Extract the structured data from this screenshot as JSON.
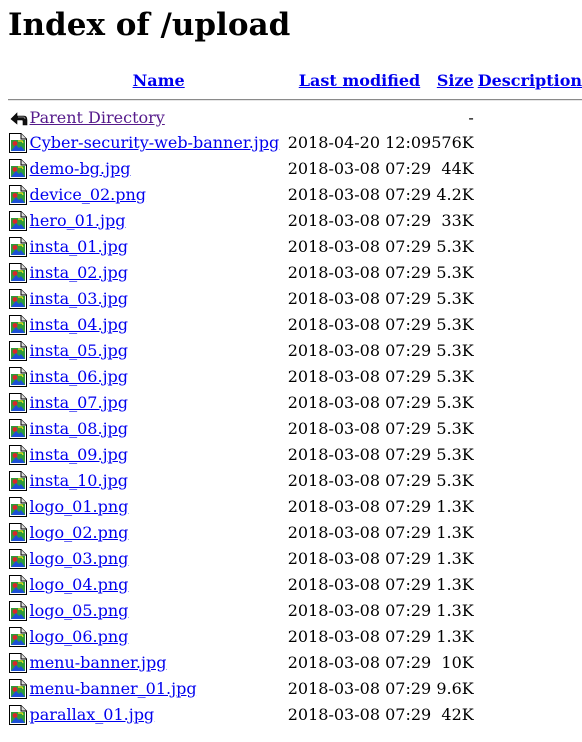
{
  "page": {
    "title": "Index of /upload"
  },
  "headers": {
    "name": "Name",
    "last_modified": "Last modified",
    "size": "Size",
    "description": "Description"
  },
  "parent": {
    "label": "Parent Directory",
    "size": "-",
    "icon": "back-icon"
  },
  "files": [
    {
      "name": "Cyber-security-web-banner.jpg",
      "modified": "2018-04-20 12:09",
      "size": "576K",
      "icon": "image-file-icon"
    },
    {
      "name": "demo-bg.jpg",
      "modified": "2018-03-08 07:29",
      "size": "44K",
      "icon": "image-file-icon"
    },
    {
      "name": "device_02.png",
      "modified": "2018-03-08 07:29",
      "size": "4.2K",
      "icon": "image-file-icon"
    },
    {
      "name": "hero_01.jpg",
      "modified": "2018-03-08 07:29",
      "size": "33K",
      "icon": "image-file-icon"
    },
    {
      "name": "insta_01.jpg",
      "modified": "2018-03-08 07:29",
      "size": "5.3K",
      "icon": "image-file-icon"
    },
    {
      "name": "insta_02.jpg",
      "modified": "2018-03-08 07:29",
      "size": "5.3K",
      "icon": "image-file-icon"
    },
    {
      "name": "insta_03.jpg",
      "modified": "2018-03-08 07:29",
      "size": "5.3K",
      "icon": "image-file-icon"
    },
    {
      "name": "insta_04.jpg",
      "modified": "2018-03-08 07:29",
      "size": "5.3K",
      "icon": "image-file-icon"
    },
    {
      "name": "insta_05.jpg",
      "modified": "2018-03-08 07:29",
      "size": "5.3K",
      "icon": "image-file-icon"
    },
    {
      "name": "insta_06.jpg",
      "modified": "2018-03-08 07:29",
      "size": "5.3K",
      "icon": "image-file-icon"
    },
    {
      "name": "insta_07.jpg",
      "modified": "2018-03-08 07:29",
      "size": "5.3K",
      "icon": "image-file-icon"
    },
    {
      "name": "insta_08.jpg",
      "modified": "2018-03-08 07:29",
      "size": "5.3K",
      "icon": "image-file-icon"
    },
    {
      "name": "insta_09.jpg",
      "modified": "2018-03-08 07:29",
      "size": "5.3K",
      "icon": "image-file-icon"
    },
    {
      "name": "insta_10.jpg",
      "modified": "2018-03-08 07:29",
      "size": "5.3K",
      "icon": "image-file-icon"
    },
    {
      "name": "logo_01.png",
      "modified": "2018-03-08 07:29",
      "size": "1.3K",
      "icon": "image-file-icon"
    },
    {
      "name": "logo_02.png",
      "modified": "2018-03-08 07:29",
      "size": "1.3K",
      "icon": "image-file-icon"
    },
    {
      "name": "logo_03.png",
      "modified": "2018-03-08 07:29",
      "size": "1.3K",
      "icon": "image-file-icon"
    },
    {
      "name": "logo_04.png",
      "modified": "2018-03-08 07:29",
      "size": "1.3K",
      "icon": "image-file-icon"
    },
    {
      "name": "logo_05.png",
      "modified": "2018-03-08 07:29",
      "size": "1.3K",
      "icon": "image-file-icon"
    },
    {
      "name": "logo_06.png",
      "modified": "2018-03-08 07:29",
      "size": "1.3K",
      "icon": "image-file-icon"
    },
    {
      "name": "menu-banner.jpg",
      "modified": "2018-03-08 07:29",
      "size": "10K",
      "icon": "image-file-icon"
    },
    {
      "name": "menu-banner_01.jpg",
      "modified": "2018-03-08 07:29",
      "size": "9.6K",
      "icon": "image-file-icon"
    },
    {
      "name": "parallax_01.jpg",
      "modified": "2018-03-08 07:29",
      "size": "42K",
      "icon": "image-file-icon"
    }
  ],
  "colors": {
    "link": "#0000ee",
    "visited_link": "#551a8b",
    "rule": "#8a8a8a"
  }
}
